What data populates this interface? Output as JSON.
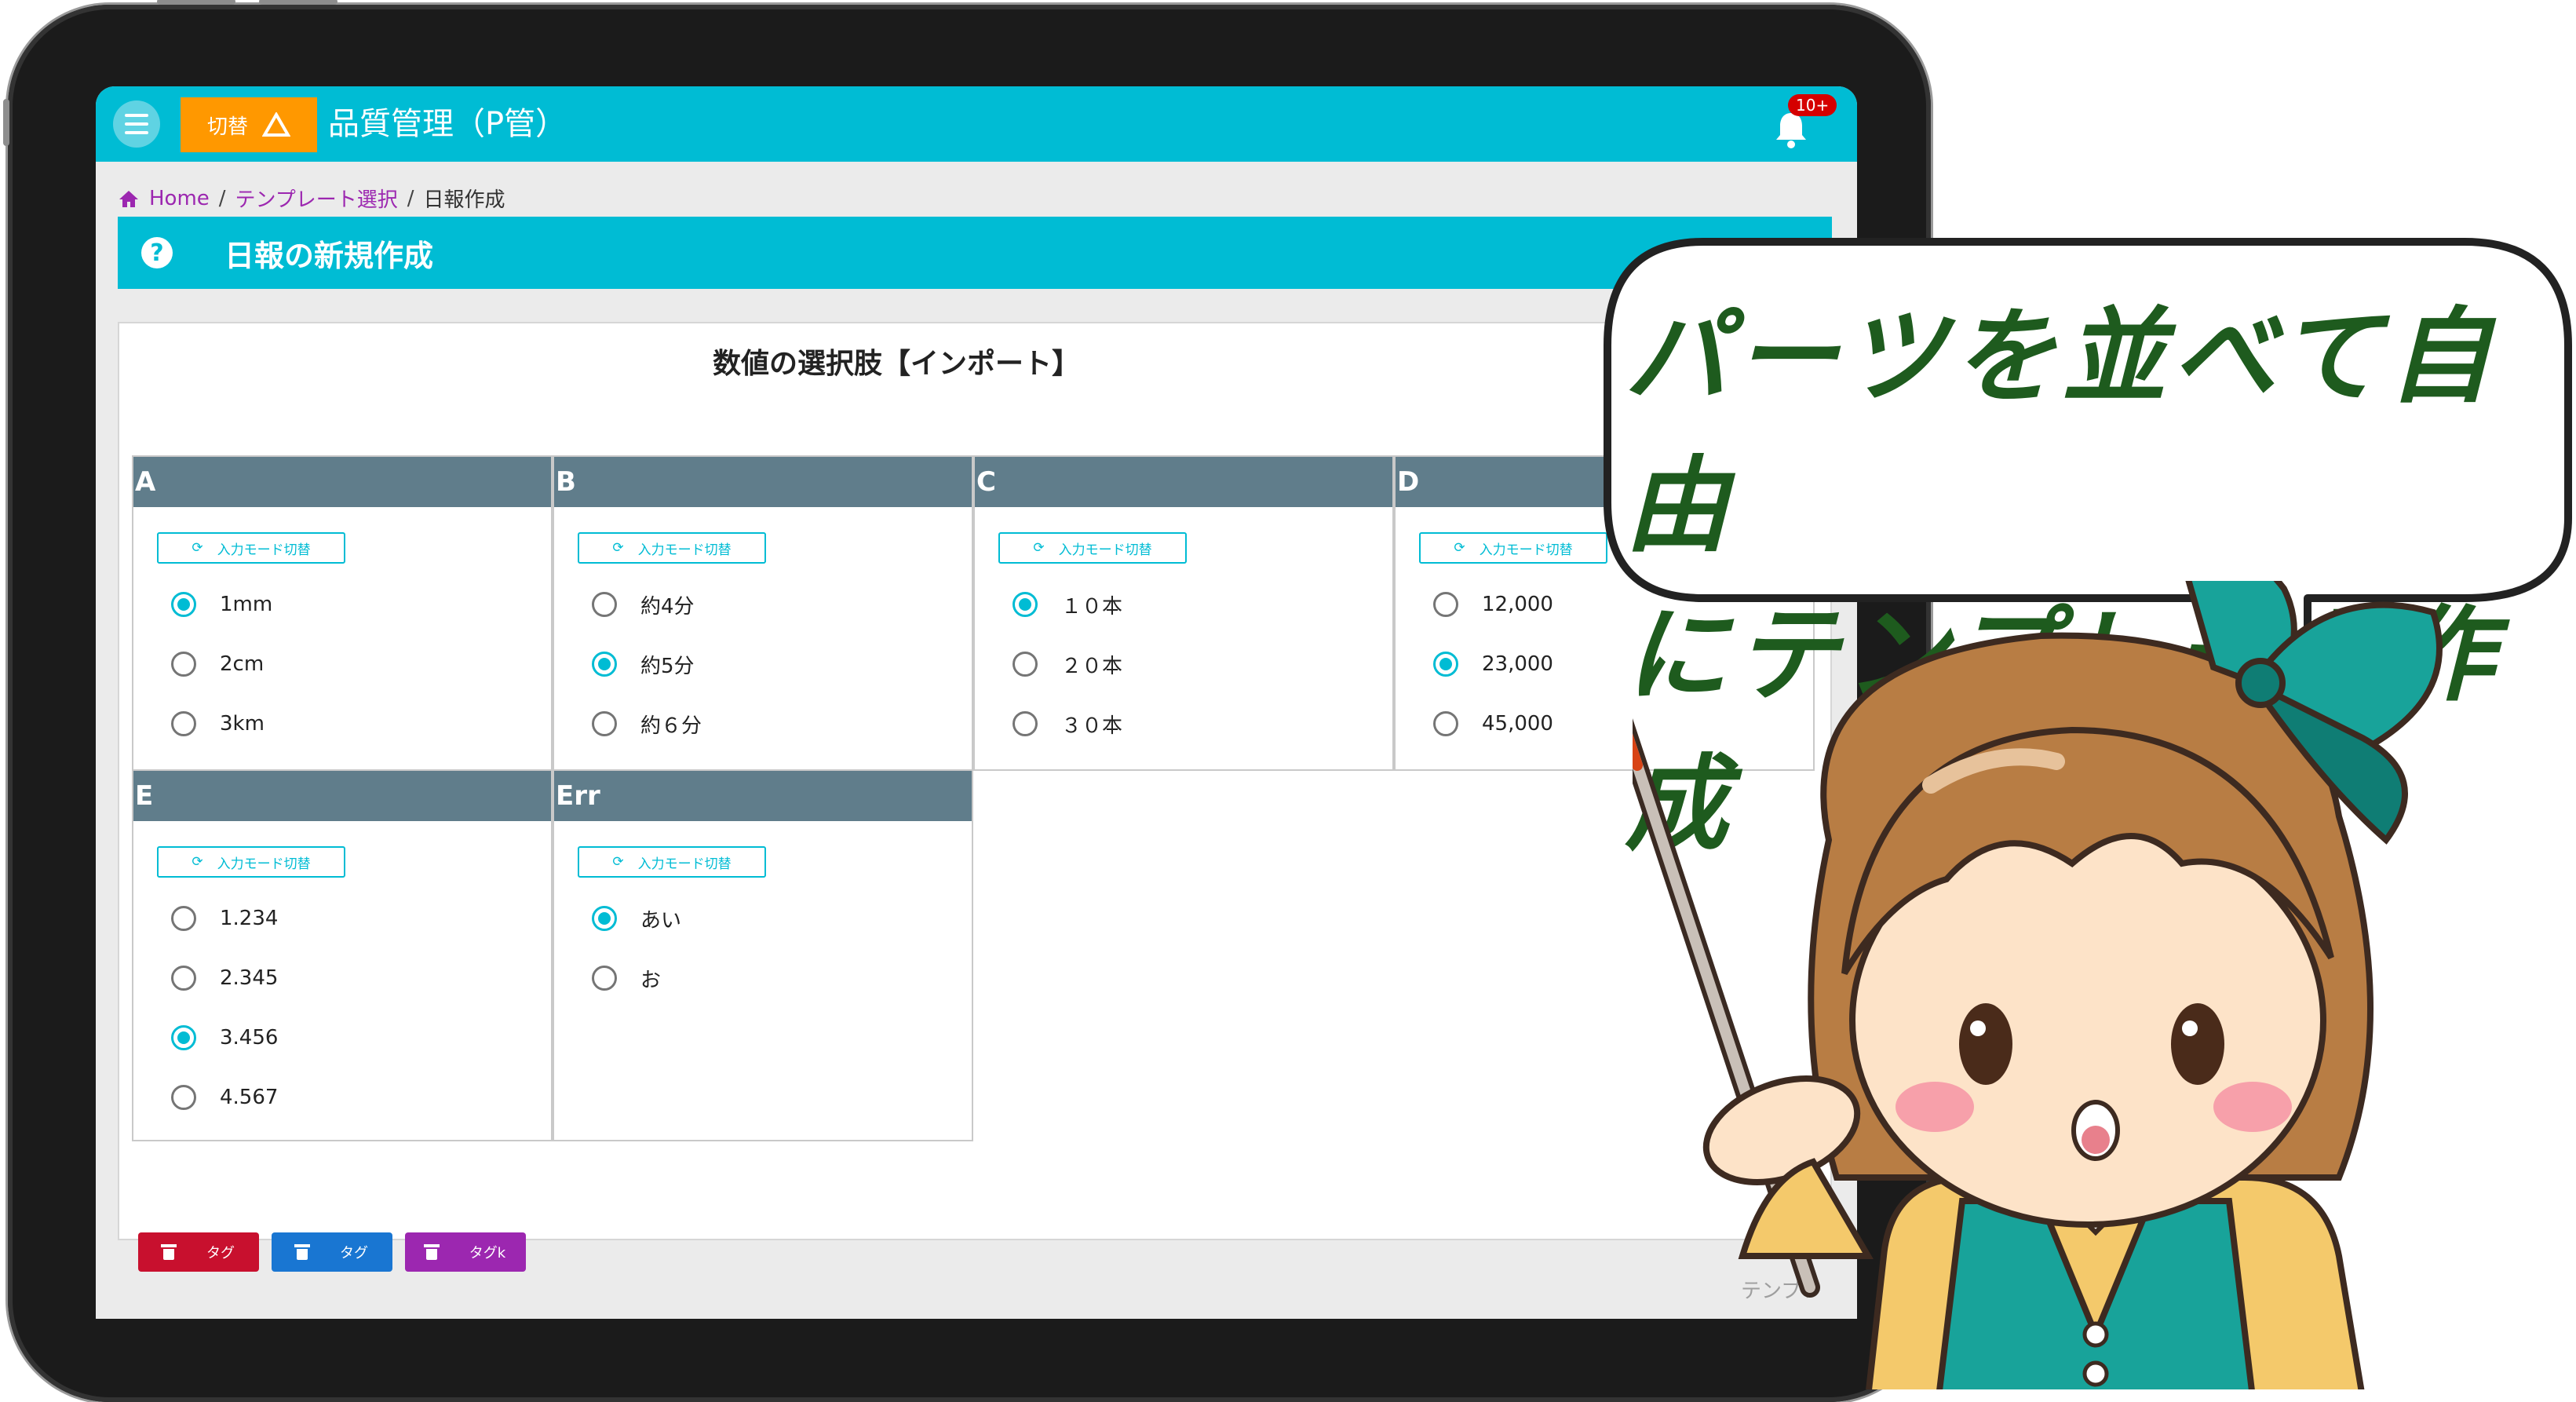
{
  "app": {
    "switch_label": "切替",
    "title": "品質管理（P管）",
    "notification_badge": "10+"
  },
  "breadcrumb": {
    "home": "Home",
    "template_select": "テンプレート選択",
    "current": "日報作成",
    "separator": "/"
  },
  "page": {
    "title": "日報の新規作成",
    "help_symbol": "?"
  },
  "form": {
    "title": "数値の選択肢【インポート】",
    "mode_button_label": "入力モード切替",
    "sections": [
      {
        "label": "A",
        "options": [
          {
            "text": "1mm",
            "selected": true
          },
          {
            "text": "2cm",
            "selected": false
          },
          {
            "text": "3km",
            "selected": false
          }
        ]
      },
      {
        "label": "B",
        "options": [
          {
            "text": "約4分",
            "selected": false
          },
          {
            "text": "約5分",
            "selected": true
          },
          {
            "text": "約６分",
            "selected": false
          }
        ]
      },
      {
        "label": "C",
        "options": [
          {
            "text": "１０本",
            "selected": true
          },
          {
            "text": "２０本",
            "selected": false
          },
          {
            "text": "３０本",
            "selected": false
          }
        ]
      },
      {
        "label": "D",
        "options": [
          {
            "text": "12,000",
            "selected": false
          },
          {
            "text": "23,000",
            "selected": true
          },
          {
            "text": "45,000",
            "selected": false
          }
        ]
      },
      {
        "label": "E",
        "options": [
          {
            "text": "1.234",
            "selected": false
          },
          {
            "text": "2.345",
            "selected": false
          },
          {
            "text": "3.456",
            "selected": true
          },
          {
            "text": "4.567",
            "selected": false
          }
        ]
      },
      {
        "label": "Err",
        "options": [
          {
            "text": "あい",
            "selected": true
          },
          {
            "text": "お",
            "selected": false
          }
        ]
      }
    ],
    "tags": [
      {
        "label": "タグ",
        "color": "#c8102e"
      },
      {
        "label": "タグ",
        "color": "#1976d2"
      },
      {
        "label": "タグk",
        "color": "#9c27b0"
      }
    ],
    "footer_hint": "テンプレ"
  },
  "callout": {
    "line1": "パーツを並べて自由",
    "line2": "にテンプレート作成"
  },
  "colors": {
    "primary": "#00bcd4",
    "accent_orange": "#ff9800",
    "section_header": "#607d8b",
    "link": "#9c27b0"
  }
}
